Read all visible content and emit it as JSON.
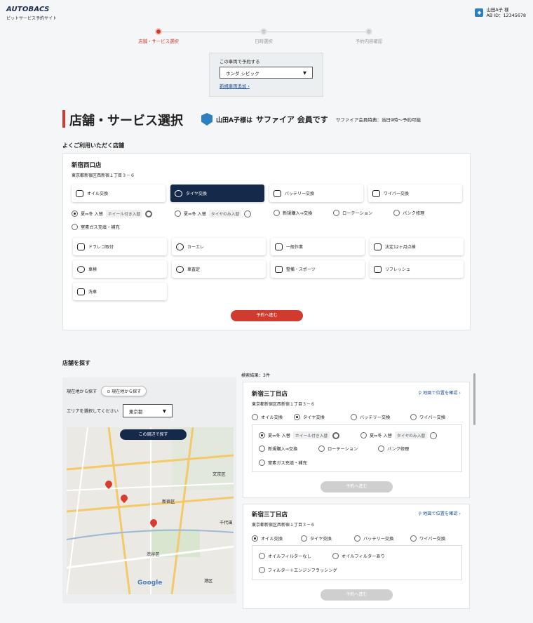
{
  "header": {
    "logo": "AUTOBACS",
    "subtitle": "ピットサービス予約サイト",
    "user_name": "山田A子 様",
    "user_id": "AB ID：12345678"
  },
  "steps": [
    {
      "label": "店舗・サービス選択",
      "active": true
    },
    {
      "label": "日時選択",
      "active": false
    },
    {
      "label": "予約内容確認",
      "active": false
    }
  ],
  "car": {
    "label": "この車両で予約する",
    "selected": "ホンダ シビック",
    "add_link": "新規車両追加 ›"
  },
  "page": {
    "title": "店舗・サービス選択",
    "member_prefix": "山田A子様は",
    "member_rank": "サファイア 会員です",
    "member_benefit": "サファイア会員特典：当日9時〜予約可能"
  },
  "favorite": {
    "heading": "よくご利用いただく店舗",
    "shop_name": "新宿西口店",
    "shop_address": "東京都新宿区西新宿１丁目３－６",
    "services_top": [
      "オイル交換",
      "タイヤ交換",
      "バッテリー交換",
      "ワイパー交換"
    ],
    "tire_options": {
      "opt1": "夏⇔冬 入替",
      "opt1_tag": "ホイール付き入替",
      "opt2": "夏⇔冬 入替",
      "opt2_tag": "タイヤのみ入替",
      "opt3": "新規購入⇒交換",
      "opt4": "ローテーション",
      "opt5": "パンク修理",
      "opt6": "窒素ガス充填・補充"
    },
    "services_more": [
      "ドラレコ取付",
      "カーエレ",
      "一般作業",
      "法定12ヶ月点検",
      "車検",
      "車査定",
      "整備・スポーツ",
      "リフレッシュ",
      "洗車"
    ],
    "button": "予約へ進む"
  },
  "search": {
    "heading": "店舗を探す",
    "current_location_label": "現在地から探す",
    "current_location_button": "現在地から探す",
    "area_label": "エリアを選択してください",
    "area_value": "東京都",
    "map_button": "この周辺で探す",
    "map_labels": {
      "bunkyo": "文京区",
      "shinjuku": "新宿区",
      "chiyoda": "千代田",
      "shibuya": "渋谷区",
      "minato": "港区",
      "google": "Google"
    },
    "results_count": "検索結果：3件"
  },
  "results": [
    {
      "name": "新宿三丁目店",
      "address": "東京都新宿区西新宿１丁目３－６",
      "map_link": "地図で位置を確認 ›",
      "services": [
        "オイル交換",
        "タイヤ交換",
        "バッテリー交換",
        "ワイパー交換"
      ],
      "options": {
        "o1": "夏⇔冬 入替",
        "o1_tag": "ホイール付き入替",
        "o2": "夏⇔冬 入替",
        "o2_tag": "タイヤのみ入替",
        "o3": "新規購入⇒交換",
        "o4": "ローテーション",
        "o5": "パンク修理",
        "o6": "窒素ガス充填・補充"
      },
      "button": "予約へ進む"
    },
    {
      "name": "新宿三丁目店",
      "address": "東京都新宿区西新宿１丁目３－６",
      "map_link": "地図で位置を確認 ›",
      "services": [
        "オイル交換",
        "タイヤ交換",
        "バッテリー交換",
        "ワイパー交換"
      ],
      "options": {
        "o1": "オイルフィルターなし",
        "o2": "オイルフィルターあり",
        "o3": "フィルター＋エンジンフラッシング"
      },
      "button": "予約へ進む"
    }
  ],
  "colors": {
    "accent": "#d13a2e",
    "navy": "#15294a",
    "link": "#1a4f94"
  }
}
